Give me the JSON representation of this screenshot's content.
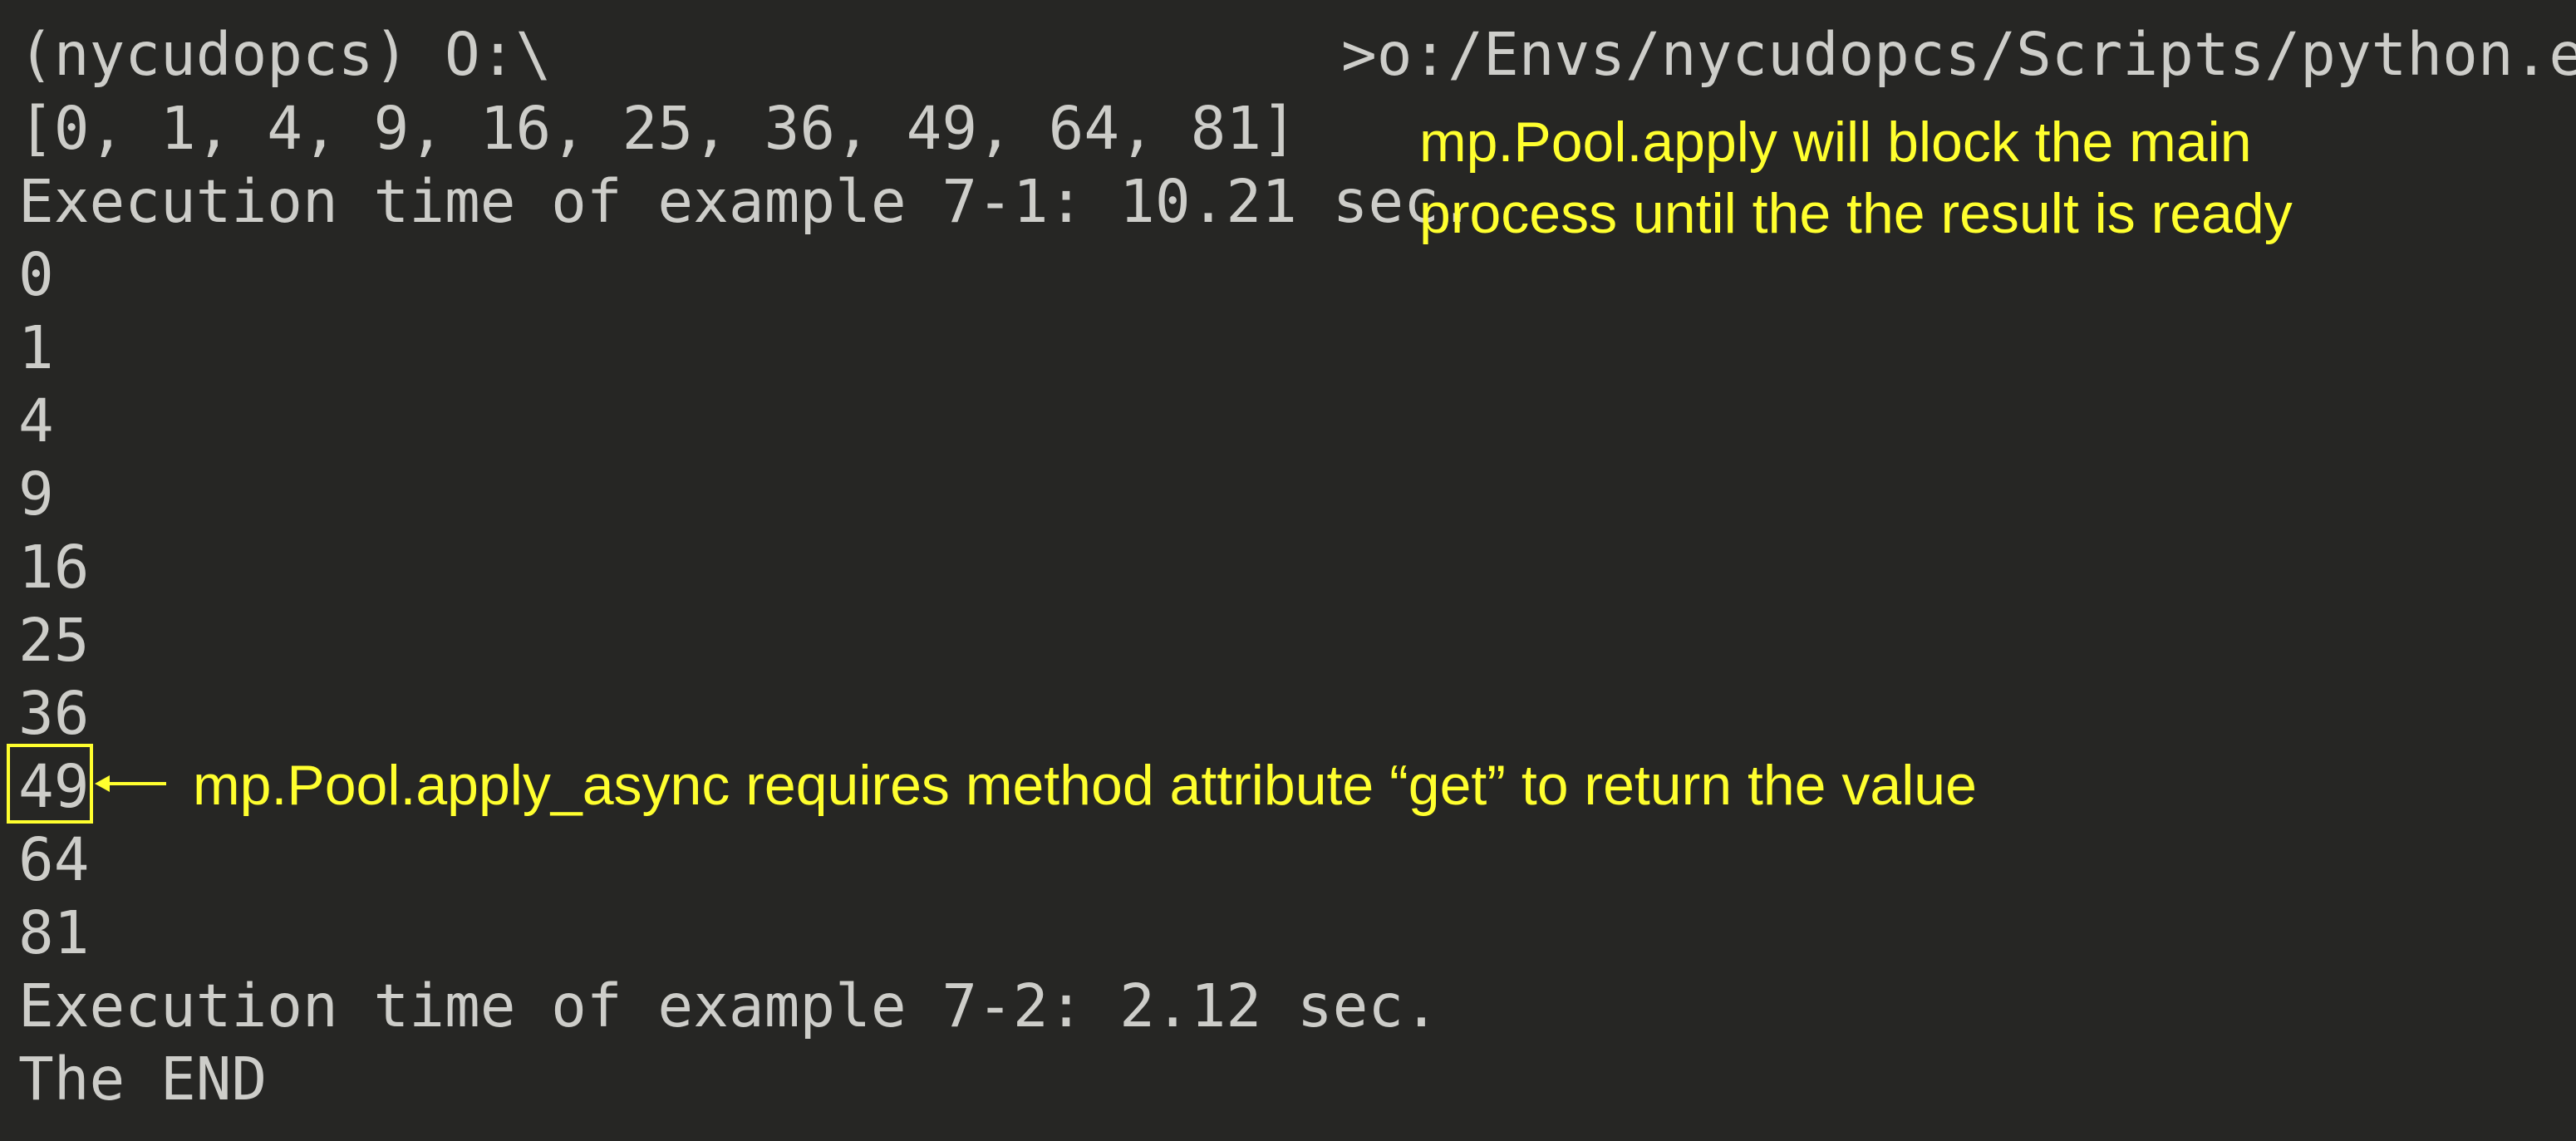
{
  "terminal": {
    "prompt": "(nycudopcs) O:\\",
    "prompt_path": ">o:/Envs/nycudopcs/Scripts/python.exe",
    "lines": [
      "[0, 1, 4, 9, 16, 25, 36, 49, 64, 81]",
      "Execution time of example 7-1: 10.21 sec.",
      "0",
      "1",
      "4",
      "9",
      "16",
      "25",
      "36",
      "49",
      "64",
      "81",
      "Execution time of example 7-2: 2.12 sec.",
      "The END"
    ]
  },
  "annotations": {
    "apply_note_line1": "mp.Pool.apply will block the main",
    "apply_note_line2": "process until the the result is ready",
    "apply_async_note": "mp.Pool.apply_async requires method attribute “get” to return the value"
  },
  "colors": {
    "background": "#262624",
    "terminal_text": "#cdcdc9",
    "annotation": "#ffff2e"
  }
}
